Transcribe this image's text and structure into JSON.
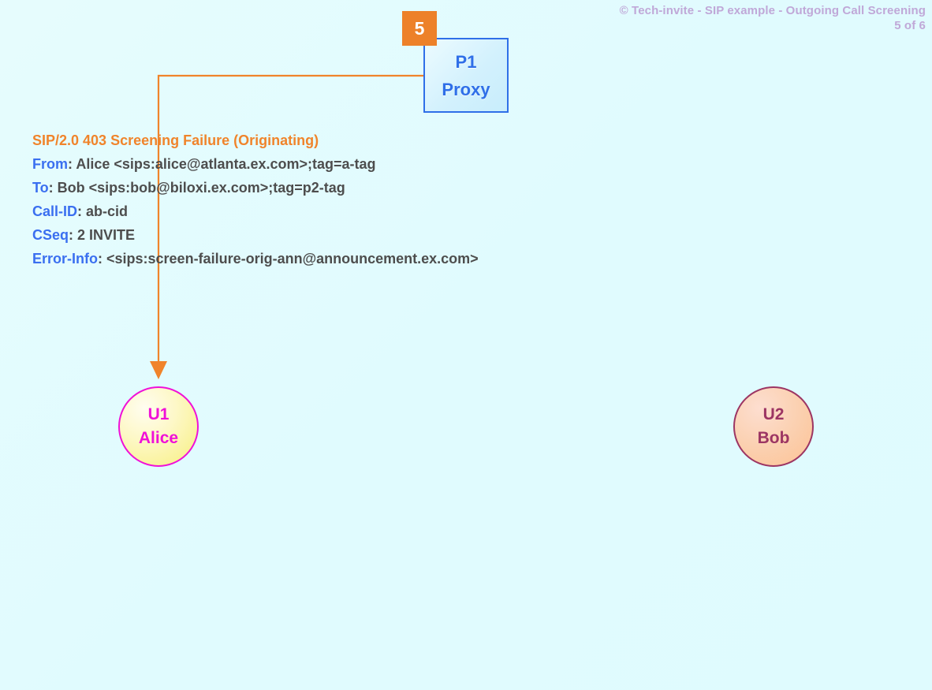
{
  "header": {
    "copyright_line": "© Tech-invite - SIP example - Outgoing Call Screening",
    "page_indicator": "5 of 6"
  },
  "step": {
    "number": "5"
  },
  "nodes": {
    "proxy": {
      "id": "P1",
      "role": "Proxy"
    },
    "caller": {
      "id": "U1",
      "name": "Alice"
    },
    "callee": {
      "id": "U2",
      "name": "Bob"
    }
  },
  "message": {
    "request_line": "SIP/2.0 403 Screening Failure (Originating)",
    "headers": [
      {
        "name": "From",
        "sep": ": ",
        "value": "Alice <sips:alice@atlanta.ex.com>;tag=a-tag"
      },
      {
        "name": "To",
        "sep": ": ",
        "value": "Bob <sips:bob@biloxi.ex.com>;tag=p2-tag"
      },
      {
        "name": "Call-ID",
        "sep": ": ",
        "value": "ab-cid"
      },
      {
        "name": "CSeq",
        "sep": ": ",
        "value": "2 INVITE"
      },
      {
        "name": "Error-Info",
        "sep": ": ",
        "value": "<sips:screen-failure-orig-ann@announcement.ex.com>"
      }
    ]
  },
  "arrow": {
    "label": "response-arrow-proxy-to-alice",
    "direction": "proxy-to-caller"
  },
  "colors": {
    "background": "#e0fbfe",
    "badge_orange": "#ed8129",
    "arrow_orange": "#f0842b",
    "request_line_orange": "#f0842b",
    "header_name_blue": "#3a6ff0",
    "header_value_gray": "#4d4d4d",
    "proxy_blue": "#2f6fe8",
    "caller_magenta": "#f010d8",
    "callee_maroon": "#9c3563",
    "title_purple": "#c0a8d8"
  }
}
